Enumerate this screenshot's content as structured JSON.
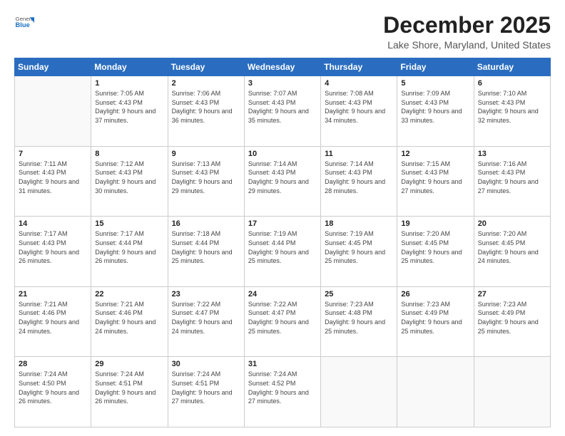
{
  "logo": {
    "general": "General",
    "blue": "Blue"
  },
  "header": {
    "month": "December 2025",
    "location": "Lake Shore, Maryland, United States"
  },
  "weekdays": [
    "Sunday",
    "Monday",
    "Tuesday",
    "Wednesday",
    "Thursday",
    "Friday",
    "Saturday"
  ],
  "weeks": [
    [
      {
        "day": "",
        "sunrise": "",
        "sunset": "",
        "daylight": ""
      },
      {
        "day": "1",
        "sunrise": "Sunrise: 7:05 AM",
        "sunset": "Sunset: 4:43 PM",
        "daylight": "Daylight: 9 hours and 37 minutes."
      },
      {
        "day": "2",
        "sunrise": "Sunrise: 7:06 AM",
        "sunset": "Sunset: 4:43 PM",
        "daylight": "Daylight: 9 hours and 36 minutes."
      },
      {
        "day": "3",
        "sunrise": "Sunrise: 7:07 AM",
        "sunset": "Sunset: 4:43 PM",
        "daylight": "Daylight: 9 hours and 35 minutes."
      },
      {
        "day": "4",
        "sunrise": "Sunrise: 7:08 AM",
        "sunset": "Sunset: 4:43 PM",
        "daylight": "Daylight: 9 hours and 34 minutes."
      },
      {
        "day": "5",
        "sunrise": "Sunrise: 7:09 AM",
        "sunset": "Sunset: 4:43 PM",
        "daylight": "Daylight: 9 hours and 33 minutes."
      },
      {
        "day": "6",
        "sunrise": "Sunrise: 7:10 AM",
        "sunset": "Sunset: 4:43 PM",
        "daylight": "Daylight: 9 hours and 32 minutes."
      }
    ],
    [
      {
        "day": "7",
        "sunrise": "Sunrise: 7:11 AM",
        "sunset": "Sunset: 4:43 PM",
        "daylight": "Daylight: 9 hours and 31 minutes."
      },
      {
        "day": "8",
        "sunrise": "Sunrise: 7:12 AM",
        "sunset": "Sunset: 4:43 PM",
        "daylight": "Daylight: 9 hours and 30 minutes."
      },
      {
        "day": "9",
        "sunrise": "Sunrise: 7:13 AM",
        "sunset": "Sunset: 4:43 PM",
        "daylight": "Daylight: 9 hours and 29 minutes."
      },
      {
        "day": "10",
        "sunrise": "Sunrise: 7:14 AM",
        "sunset": "Sunset: 4:43 PM",
        "daylight": "Daylight: 9 hours and 29 minutes."
      },
      {
        "day": "11",
        "sunrise": "Sunrise: 7:14 AM",
        "sunset": "Sunset: 4:43 PM",
        "daylight": "Daylight: 9 hours and 28 minutes."
      },
      {
        "day": "12",
        "sunrise": "Sunrise: 7:15 AM",
        "sunset": "Sunset: 4:43 PM",
        "daylight": "Daylight: 9 hours and 27 minutes."
      },
      {
        "day": "13",
        "sunrise": "Sunrise: 7:16 AM",
        "sunset": "Sunset: 4:43 PM",
        "daylight": "Daylight: 9 hours and 27 minutes."
      }
    ],
    [
      {
        "day": "14",
        "sunrise": "Sunrise: 7:17 AM",
        "sunset": "Sunset: 4:43 PM",
        "daylight": "Daylight: 9 hours and 26 minutes."
      },
      {
        "day": "15",
        "sunrise": "Sunrise: 7:17 AM",
        "sunset": "Sunset: 4:44 PM",
        "daylight": "Daylight: 9 hours and 26 minutes."
      },
      {
        "day": "16",
        "sunrise": "Sunrise: 7:18 AM",
        "sunset": "Sunset: 4:44 PM",
        "daylight": "Daylight: 9 hours and 25 minutes."
      },
      {
        "day": "17",
        "sunrise": "Sunrise: 7:19 AM",
        "sunset": "Sunset: 4:44 PM",
        "daylight": "Daylight: 9 hours and 25 minutes."
      },
      {
        "day": "18",
        "sunrise": "Sunrise: 7:19 AM",
        "sunset": "Sunset: 4:45 PM",
        "daylight": "Daylight: 9 hours and 25 minutes."
      },
      {
        "day": "19",
        "sunrise": "Sunrise: 7:20 AM",
        "sunset": "Sunset: 4:45 PM",
        "daylight": "Daylight: 9 hours and 25 minutes."
      },
      {
        "day": "20",
        "sunrise": "Sunrise: 7:20 AM",
        "sunset": "Sunset: 4:45 PM",
        "daylight": "Daylight: 9 hours and 24 minutes."
      }
    ],
    [
      {
        "day": "21",
        "sunrise": "Sunrise: 7:21 AM",
        "sunset": "Sunset: 4:46 PM",
        "daylight": "Daylight: 9 hours and 24 minutes."
      },
      {
        "day": "22",
        "sunrise": "Sunrise: 7:21 AM",
        "sunset": "Sunset: 4:46 PM",
        "daylight": "Daylight: 9 hours and 24 minutes."
      },
      {
        "day": "23",
        "sunrise": "Sunrise: 7:22 AM",
        "sunset": "Sunset: 4:47 PM",
        "daylight": "Daylight: 9 hours and 24 minutes."
      },
      {
        "day": "24",
        "sunrise": "Sunrise: 7:22 AM",
        "sunset": "Sunset: 4:47 PM",
        "daylight": "Daylight: 9 hours and 25 minutes."
      },
      {
        "day": "25",
        "sunrise": "Sunrise: 7:23 AM",
        "sunset": "Sunset: 4:48 PM",
        "daylight": "Daylight: 9 hours and 25 minutes."
      },
      {
        "day": "26",
        "sunrise": "Sunrise: 7:23 AM",
        "sunset": "Sunset: 4:49 PM",
        "daylight": "Daylight: 9 hours and 25 minutes."
      },
      {
        "day": "27",
        "sunrise": "Sunrise: 7:23 AM",
        "sunset": "Sunset: 4:49 PM",
        "daylight": "Daylight: 9 hours and 25 minutes."
      }
    ],
    [
      {
        "day": "28",
        "sunrise": "Sunrise: 7:24 AM",
        "sunset": "Sunset: 4:50 PM",
        "daylight": "Daylight: 9 hours and 26 minutes."
      },
      {
        "day": "29",
        "sunrise": "Sunrise: 7:24 AM",
        "sunset": "Sunset: 4:51 PM",
        "daylight": "Daylight: 9 hours and 26 minutes."
      },
      {
        "day": "30",
        "sunrise": "Sunrise: 7:24 AM",
        "sunset": "Sunset: 4:51 PM",
        "daylight": "Daylight: 9 hours and 27 minutes."
      },
      {
        "day": "31",
        "sunrise": "Sunrise: 7:24 AM",
        "sunset": "Sunset: 4:52 PM",
        "daylight": "Daylight: 9 hours and 27 minutes."
      },
      {
        "day": "",
        "sunrise": "",
        "sunset": "",
        "daylight": ""
      },
      {
        "day": "",
        "sunrise": "",
        "sunset": "",
        "daylight": ""
      },
      {
        "day": "",
        "sunrise": "",
        "sunset": "",
        "daylight": ""
      }
    ]
  ]
}
